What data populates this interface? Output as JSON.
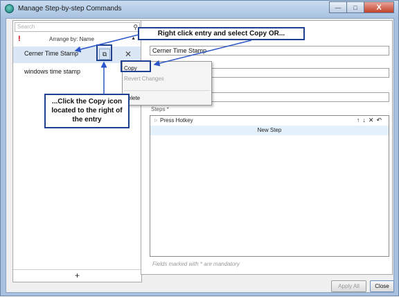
{
  "window": {
    "title": "Manage Step-by-step Commands",
    "buttons": {
      "minimize": "—",
      "maximize": "□",
      "close": "X"
    }
  },
  "left": {
    "search_placeholder": "Search",
    "required_mark": "!",
    "arrange_label": "Arrange by: Name",
    "entries": [
      {
        "label": "Cerner Time Stamp",
        "selected": true
      },
      {
        "label": "windows time stamp",
        "selected": false
      }
    ],
    "add_label": "+"
  },
  "right": {
    "name_value": "Cerner Time Stamp",
    "steps_label": "Steps *",
    "steps": [
      {
        "label": "Press Hotkey"
      }
    ],
    "step_controls": "↑↓✕↶",
    "new_step_label": "New Step",
    "mandatory_note": "Fields marked with * are mandatory"
  },
  "context_menu": {
    "items": [
      "Copy",
      "Revert Changes",
      "Delete"
    ]
  },
  "footer": {
    "apply_label": "Apply All",
    "close_label": "Close"
  },
  "callouts": {
    "top": "Right click entry and select Copy OR...",
    "left": "...Click the Copy icon located to the right of the entry"
  },
  "colors": {
    "callout_border": "#1f3f8f",
    "selection": "#dbe7f4",
    "close_button": "#c4402b"
  }
}
